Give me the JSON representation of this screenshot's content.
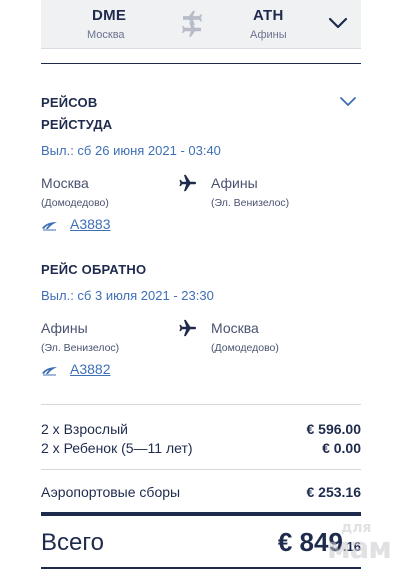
{
  "route": {
    "from_code": "DME",
    "from_city": "Москва",
    "to_code": "ATH",
    "to_city": "Афины"
  },
  "flights_heading": "РЕЙСОВ",
  "outbound": {
    "heading": "РЕЙСТУДА",
    "departs": "Выл.: сб 26 июня 2021 - 03:40",
    "from_city": "Москва",
    "from_airport": "(Домодедово)",
    "to_city": "Афины",
    "to_airport": "(Эл. Венизелос)",
    "flight_number": "A3883"
  },
  "inbound": {
    "heading": "РЕЙС ОБРАТНО",
    "departs": "Выл.: сб 3 июля 2021 - 23:30",
    "from_city": "Афины",
    "from_airport": "(Эл. Венизелос)",
    "to_city": "Москва",
    "to_airport": "(Домодедово)",
    "flight_number": "A3882"
  },
  "prices": {
    "adult_label": "2 x Взрослый",
    "adult_amount": "€ 596.00",
    "child_label": "2 x Ребенок (5—11 лет)",
    "child_amount": "€ 0.00",
    "fees_label": "Аэропортовые сборы",
    "fees_amount": "€ 253.16"
  },
  "total": {
    "label": "Всего",
    "currency": "€",
    "whole": "849",
    "cents": ".16"
  },
  "watermark": {
    "line1": "для",
    "line2": "мам"
  },
  "colors": {
    "navy": "#1f2b4d",
    "link_blue": "#3e6fb5",
    "header_bg": "#f0f1f3"
  }
}
